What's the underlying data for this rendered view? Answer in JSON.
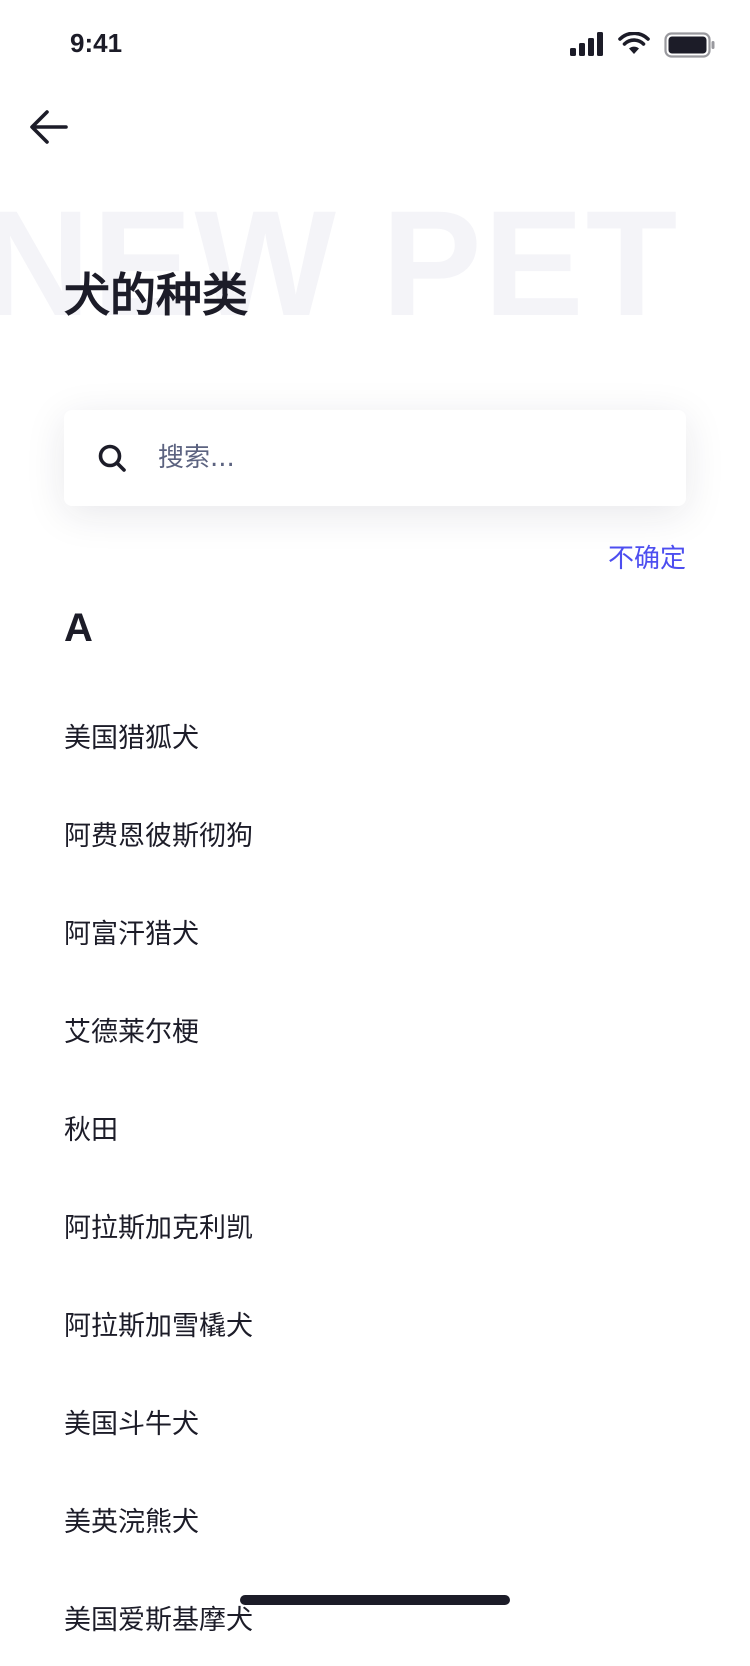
{
  "status_bar": {
    "time": "9:41",
    "icons": [
      "signal-icon",
      "wifi-icon",
      "battery-icon"
    ]
  },
  "header": {
    "back_icon": "arrow-left-icon",
    "watermark": "NEW PET",
    "title": "犬的种类"
  },
  "search": {
    "icon": "search-icon",
    "placeholder": "搜索..."
  },
  "not_sure_label": "不确定",
  "section": {
    "letter": "A",
    "items": [
      "美国猎狐犬",
      "阿费恩彼斯彻狗",
      "阿富汗猎犬",
      "艾德莱尔梗",
      "秋田",
      "阿拉斯加克利凯",
      "阿拉斯加雪橇犬",
      "美国斗牛犬",
      "美英浣熊犬",
      "美国爱斯基摩犬"
    ]
  },
  "colors": {
    "text": "#1c1c28",
    "accent": "#4d4ef0",
    "placeholder": "#5c6380",
    "watermark": "#f4f4f8"
  }
}
